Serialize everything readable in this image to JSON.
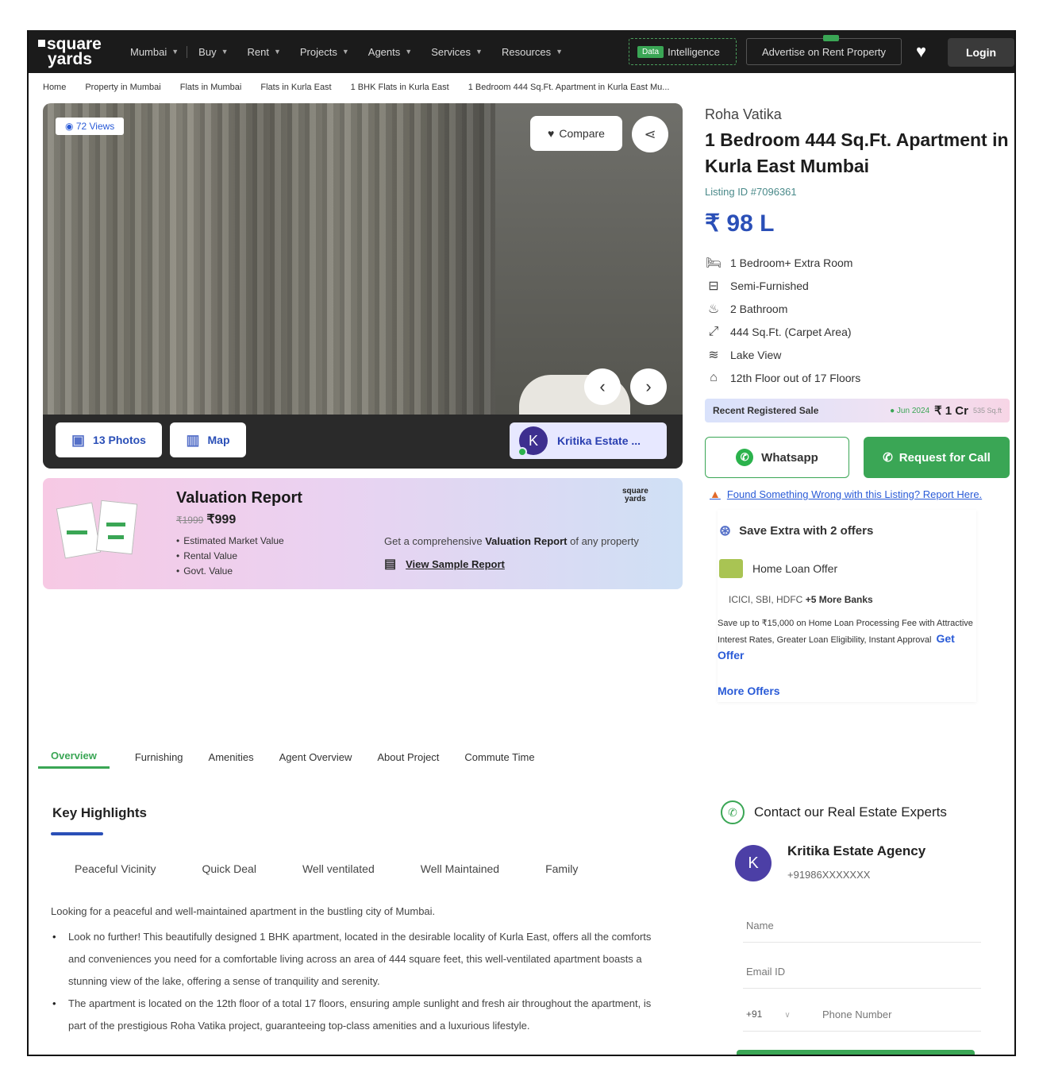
{
  "nav": {
    "logo_line1": "square",
    "logo_line2": "yards",
    "menu": [
      {
        "label": "Mumbai"
      },
      {
        "label": "Buy"
      },
      {
        "label": "Rent"
      },
      {
        "label": "Projects"
      },
      {
        "label": "Agents"
      },
      {
        "label": "Services"
      },
      {
        "label": "Resources"
      }
    ],
    "data_badge": "Data",
    "data_label": "Intelligence",
    "advertise_label": "Advertise on Rent Property",
    "login_label": "Login"
  },
  "breadcrumb": [
    "Home",
    "Property in Mumbai",
    "Flats in Mumbai",
    "Flats in Kurla East",
    "1 BHK Flats in Kurla East",
    "1 Bedroom 444 Sq.Ft. Apartment in Kurla East Mu..."
  ],
  "gallery": {
    "views": "72 Views",
    "compare_label": "Compare",
    "photos_label": "13 Photos",
    "map_label": "Map",
    "agent_initial": "K",
    "agent_label": "Kritika Estate ..."
  },
  "valuation": {
    "title": "Valuation Report",
    "old_price": "₹1999",
    "price": "₹999",
    "bullets": [
      "Estimated Market Value",
      "Rental Value",
      "Govt. Value"
    ],
    "brand_line1": "square",
    "brand_line2": "yards",
    "cta_prefix": "Get a comprehensive",
    "cta_bold": "Valuation Report",
    "cta_suffix": "of any property",
    "sample_label": "View Sample Report"
  },
  "listing": {
    "project": "Roha Vatika",
    "title": "1 Bedroom 444 Sq.Ft. Apartment in Kurla East Mumbai",
    "listing_id": "Listing ID #7096361",
    "price": "₹ 98 L",
    "features": [
      {
        "icon": "bed-icon",
        "text": "1 Bedroom+ Extra Room"
      },
      {
        "icon": "sofa-icon",
        "text": "Semi-Furnished"
      },
      {
        "icon": "bathtub-icon",
        "text": "2 Bathroom"
      },
      {
        "icon": "area-icon",
        "text": "444 Sq.Ft. (Carpet Area)"
      },
      {
        "icon": "lake-icon",
        "text": "Lake View"
      },
      {
        "icon": "floor-icon",
        "text": "12th Floor out of 17 Floors"
      }
    ],
    "recent_label": "Recent Registered Sale",
    "recent_date": "Jun 2024",
    "recent_amount": "₹ 1 Cr",
    "recent_area": "535 Sq.ft",
    "whatsapp_label": "Whatsapp",
    "call_label": "Request for Call",
    "report_text": "Found Something Wrong with this Listing? Report Here."
  },
  "offers": {
    "save_extra": "Save Extra with 2 offers",
    "loan_title": "Home Loan Offer",
    "banks_prefix": "ICICI, SBI, HDFC",
    "banks_more": "+5 More Banks",
    "desc": "Save up to ₹15,000 on Home Loan Processing Fee with Attractive Interest Rates, Greater Loan Eligibility, Instant Approval",
    "get_offer": "Get Offer",
    "more_offers": "More Offers"
  },
  "tabs": [
    "Overview",
    "Furnishing",
    "Amenities",
    "Agent Overview",
    "About Project",
    "Commute Time"
  ],
  "highlights": {
    "title": "Key Highlights",
    "chips": [
      "Peaceful Vicinity",
      "Quick Deal",
      "Well ventilated",
      "Well Maintained",
      "Family"
    ],
    "intro": "Looking for a peaceful and well-maintained apartment in the bustling city of Mumbai.",
    "points": [
      "Look no further! This beautifully designed 1 BHK apartment, located in the desirable locality of Kurla East, offers all the comforts and conveniences you need for a comfortable living across an area of 444 square feet, this well-ventilated apartment boasts a stunning view of the lake, offering a sense of tranquility and serenity.",
      "The apartment is located on the 12th floor of a total 17 floors, ensuring ample sunlight and fresh air throughout the apartment, is part of the prestigious Roha Vatika project, guaranteeing top-class amenities and a luxurious lifestyle."
    ]
  },
  "contact": {
    "title": "Contact our Real Estate Experts",
    "agent_initial": "K",
    "agent_name": "Kritika Estate Agency",
    "agent_phone": "+91986XXXXXXX",
    "name_label": "Name",
    "email_label": "Email ID",
    "country_code": "+91",
    "phone_label": "Phone Number"
  },
  "colors": {
    "brand_green": "#3aa655",
    "brand_blue": "#2a4fb7",
    "nav_bg": "#1b1b1b"
  }
}
